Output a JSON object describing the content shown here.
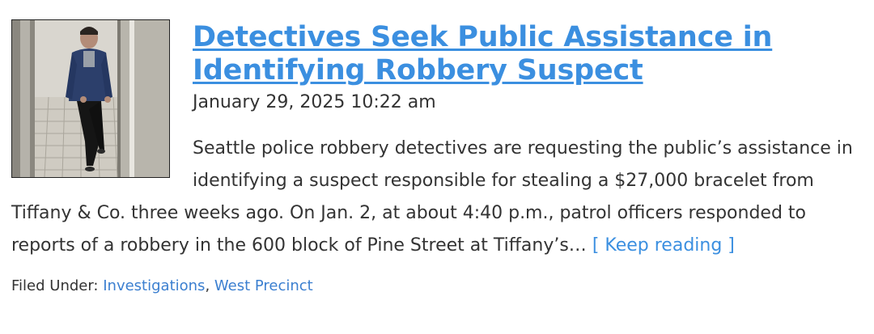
{
  "post": {
    "title": "Detectives Seek Public Assistance in Identifying Robbery Suspect",
    "date": "January 29, 2025 10:22 am",
    "excerpt": "Seattle police robbery detectives are requesting the public’s assistance in identifying a suspect responsible for stealing a $27,000 bracelet from Tiffany & Co. three weeks ago. On Jan. 2, at about 4:40 p.m., patrol officers responded to reports of a robbery in the 600 block of Pine Street at Tiffany’s…",
    "read_more": "[ Keep reading ]",
    "filed_under_label": "Filed Under:",
    "categories": [
      {
        "label": "Investigations",
        "separator": ", "
      },
      {
        "label": "West Precinct",
        "separator": ""
      }
    ]
  },
  "colors": {
    "link": "#3b8fe0",
    "text": "#333333"
  }
}
